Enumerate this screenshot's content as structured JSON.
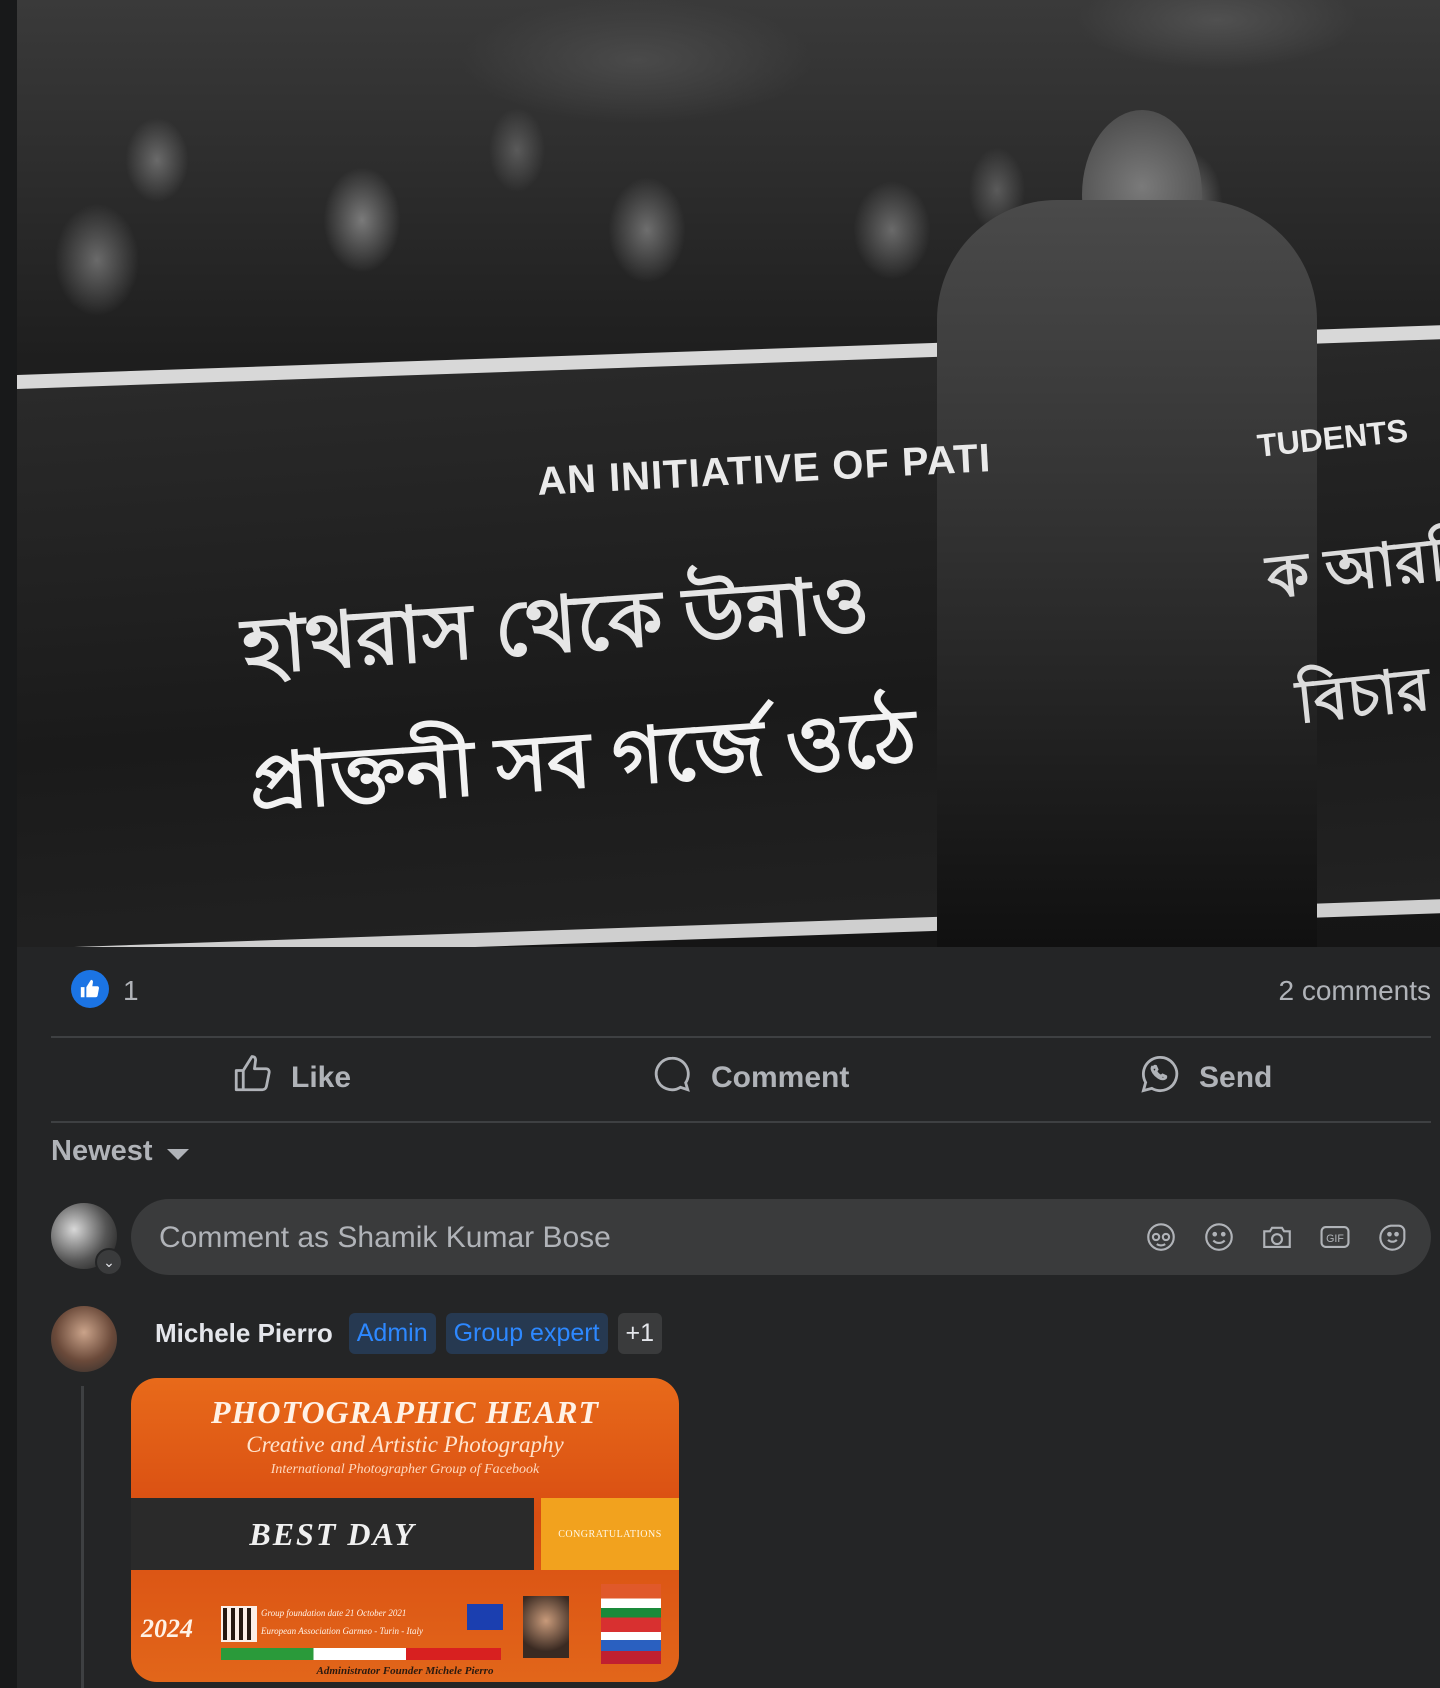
{
  "post": {
    "photo": {
      "banner_text_english": "AN INITIATIVE OF PATI",
      "banner_text_english_right": "TUDENTS",
      "banner_text_bengali_line1": "হাথরাস থেকে উন্নাও",
      "banner_text_bengali_line2": "প্রাক্তনী সব গর্জে ওঠে",
      "banner_text_bengali_right1": "ক আরজি",
      "banner_text_bengali_right2": "বিচার"
    },
    "reactions": {
      "like_count": "1",
      "comments_label": "2 comments"
    },
    "actions": {
      "like_label": "Like",
      "comment_label": "Comment",
      "send_label": "Send"
    },
    "sort": {
      "label": "Newest"
    },
    "composer": {
      "placeholder": "Comment as Shamik Kumar Bose",
      "icons": [
        "avatar-sticker-icon",
        "emoji-icon",
        "camera-icon",
        "gif-icon",
        "sticker-icon"
      ],
      "gif_label": "GIF"
    },
    "comment": {
      "author": "Michele Pierro",
      "badges": [
        "Admin",
        "Group expert",
        "+1"
      ],
      "sticker": {
        "title": "PHOTOGRAPHIC HEART",
        "subtitle": "Creative and Artistic Photography",
        "subtitle2": "International Photographer Group of Facebook",
        "band": "BEST DAY",
        "congrats": "CONGRATULATIONS",
        "year": "2024",
        "info_line1": "Group foundation date 21 October 2021",
        "info_line2": "European Association Garmeo - Turin - Italy",
        "admin_line": "Administrator Founder Michele Pierro"
      }
    }
  },
  "colors": {
    "background": "#18191a",
    "card": "#242526",
    "input": "#3a3b3c",
    "accent_blue": "#1b74e4",
    "badge_text": "#2d88ff",
    "muted_text": "#b0b3b8"
  }
}
